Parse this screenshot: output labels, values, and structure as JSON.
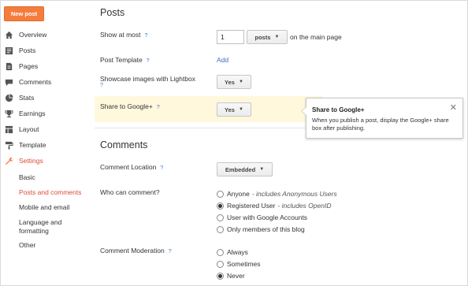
{
  "sidebar": {
    "new_post": "New post",
    "items": [
      {
        "label": "Overview",
        "icon": "home-icon"
      },
      {
        "label": "Posts",
        "icon": "posts-icon"
      },
      {
        "label": "Pages",
        "icon": "pages-icon"
      },
      {
        "label": "Comments",
        "icon": "comment-icon"
      },
      {
        "label": "Stats",
        "icon": "pie-chart-icon"
      },
      {
        "label": "Earnings",
        "icon": "trophy-icon"
      },
      {
        "label": "Layout",
        "icon": "layout-icon"
      },
      {
        "label": "Template",
        "icon": "paint-roller-icon"
      },
      {
        "label": "Settings",
        "icon": "wrench-icon"
      }
    ],
    "sub_items": [
      {
        "label": "Basic"
      },
      {
        "label": "Posts and comments"
      },
      {
        "label": "Mobile and email"
      },
      {
        "label": "Language and formatting",
        "line1": "Language and",
        "line2": "formatting"
      },
      {
        "label": "Other"
      }
    ]
  },
  "posts": {
    "title": "Posts",
    "show_at_most": {
      "label": "Show at most",
      "help": "?",
      "value": "1",
      "unit": "posts",
      "suffix": "on the main page"
    },
    "post_template": {
      "label": "Post Template",
      "help": "?",
      "action": "Add"
    },
    "lightbox": {
      "label": "Showcase images with Lightbox",
      "help": "?",
      "value": "Yes"
    },
    "google_plus": {
      "label": "Share to Google+",
      "help": "?",
      "value": "Yes"
    }
  },
  "tooltip": {
    "title": "Share to Google+",
    "body": "When you publish a post, display the Google+ share box after publishing.",
    "close": "✕"
  },
  "comments": {
    "title": "Comments",
    "location": {
      "label": "Comment Location",
      "help": "?",
      "value": "Embedded"
    },
    "who": {
      "label": "Who can comment?",
      "options": [
        {
          "label": "Anyone",
          "note": "- includes Anonymous Users",
          "selected": false
        },
        {
          "label": "Registered User",
          "note": "- includes OpenID",
          "selected": true
        },
        {
          "label": "User with Google Accounts",
          "note": "",
          "selected": false
        },
        {
          "label": "Only members of this blog",
          "note": "",
          "selected": false
        }
      ]
    },
    "moderation": {
      "label": "Comment Moderation",
      "help": "?",
      "options": [
        {
          "label": "Always",
          "selected": false
        },
        {
          "label": "Sometimes",
          "selected": false
        },
        {
          "label": "Never",
          "selected": true
        }
      ]
    }
  },
  "colors": {
    "accent": "#f47d3d",
    "active": "#dd4b39",
    "link": "#3b6ccd",
    "highlight": "#fff8dd"
  }
}
